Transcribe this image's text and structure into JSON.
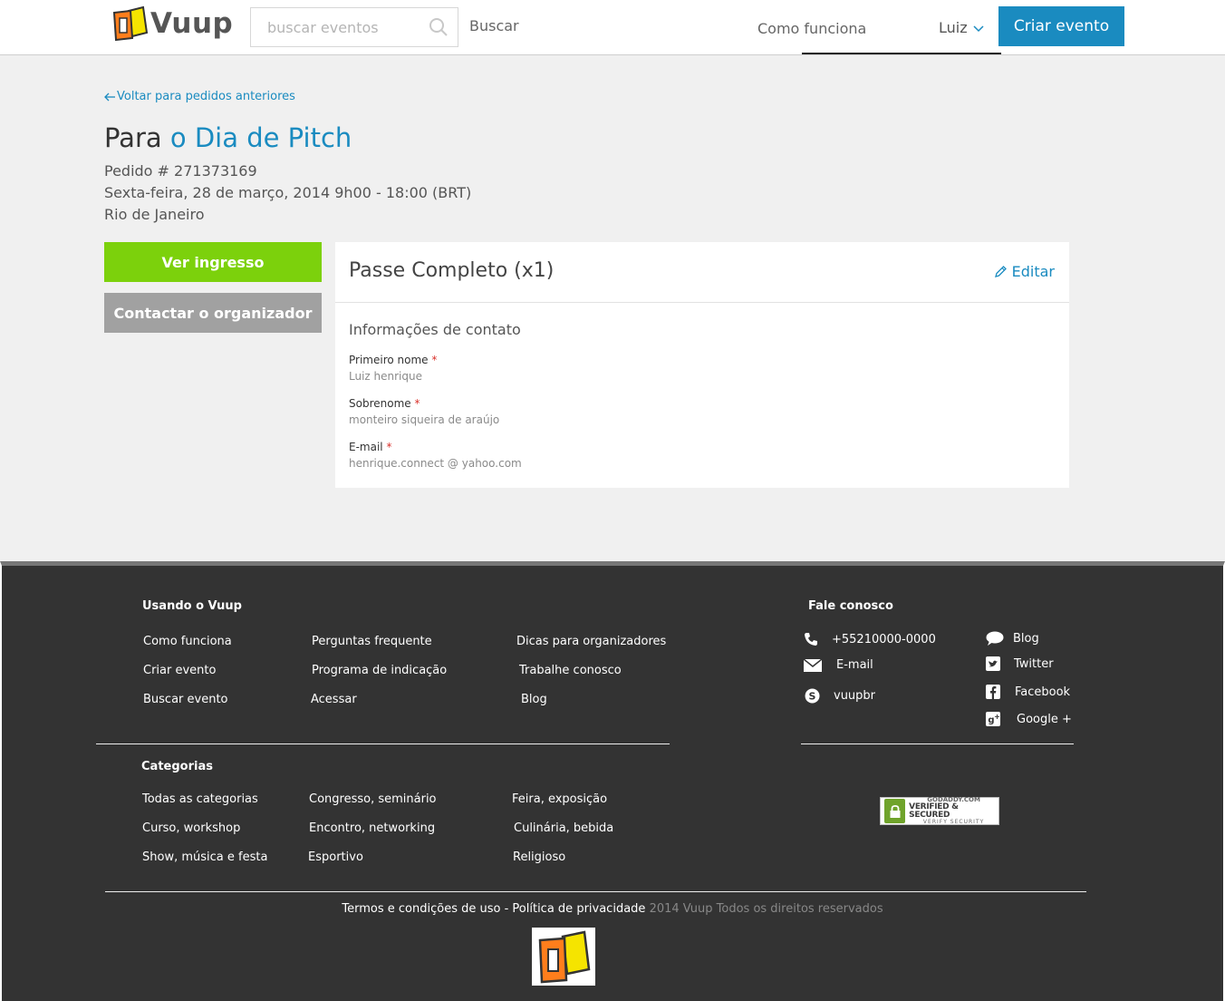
{
  "header": {
    "brand": "Vuup",
    "search_placeholder": "buscar eventos",
    "search_button": "Buscar",
    "nav_how": "Como funciona",
    "user_name": "Luiz",
    "create_event": "Criar evento"
  },
  "order": {
    "back_link": "Voltar para pedidos anteriores",
    "title_prefix": "Para",
    "event_name": "o Dia de Pitch",
    "order_number": "Pedido # 271373169",
    "date": "Sexta-feira, 28 de março, 2014 9h00 - 18:00 (BRT)",
    "city": "Rio de Janeiro",
    "view_ticket": "Ver ingresso",
    "contact_organizer": "Contactar o organizador"
  },
  "ticket": {
    "title": "Passe Completo (x1)",
    "edit": "Editar",
    "section_title": "Informações de contato",
    "fields": [
      {
        "label": "Primeiro nome",
        "required": "*",
        "value": "Luiz henrique"
      },
      {
        "label": "Sobrenome",
        "required": "*",
        "value": "monteiro siqueira de araújo"
      },
      {
        "label": "E-mail",
        "required": "*",
        "value": "henrique.connect @ yahoo.com"
      }
    ]
  },
  "footer": {
    "using_title": "Usando o Vuup",
    "using_links": [
      "Como funciona",
      "Perguntas frequente",
      "Dicas para organizadores",
      "Criar evento",
      "Programa de indicação",
      "Trabalhe conosco",
      "Buscar evento",
      "Acessar",
      "Blog"
    ],
    "contact_title": "Fale conosco",
    "contact": {
      "phone": "+55210000-0000",
      "email": "E-mail",
      "skype": "vuupbr"
    },
    "social": [
      "Blog",
      "Twitter",
      "Facebook",
      "Google +"
    ],
    "categories_title": "Categorias",
    "categories": [
      "Todas as categorias",
      "Congresso, seminário",
      "Feira, exposição",
      "Curso, workshop",
      "Encontro, networking",
      "Culinária, bebida",
      "Show, música e festa",
      "Esportivo",
      "Religioso"
    ],
    "terms": "Termos e condições de uso",
    "privacy": "Política de privacidade",
    "copyright": "2014 Vuup Todos os direitos reservados",
    "seal": {
      "line1": "GODADDY.COM",
      "line2": "VERIFIED & SECURED",
      "line3": "VERIFY SECURITY"
    }
  },
  "colors": {
    "accent": "#1a8bc0",
    "green": "#7cd10c",
    "gray_button": "#a1a1a1",
    "footer_bg": "#333333"
  }
}
